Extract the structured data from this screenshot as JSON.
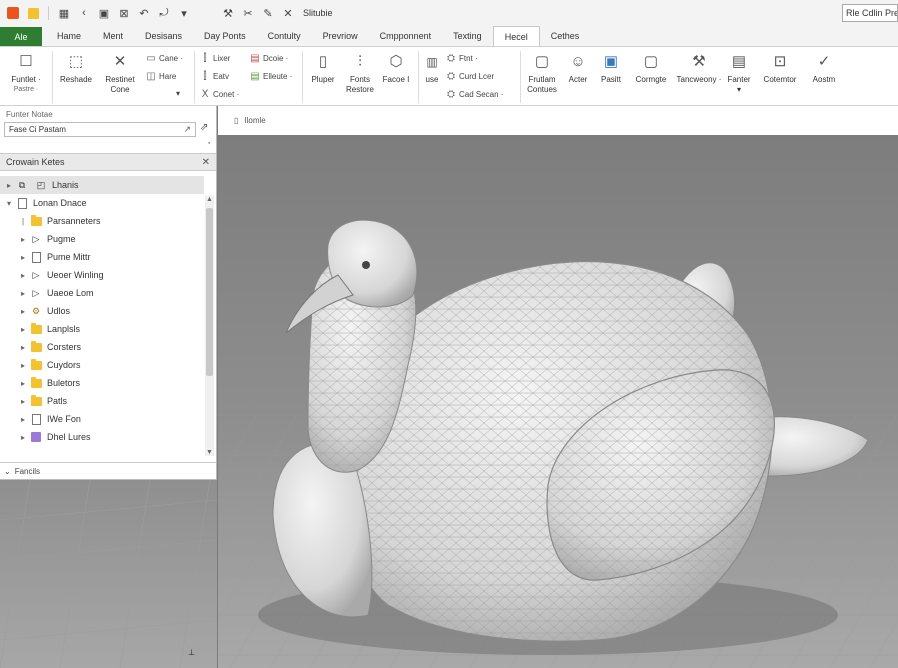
{
  "quick_access": {
    "title": "Slitubie",
    "search_placeholder": "Rle Cdlin Pre"
  },
  "tabs": {
    "file": "Ale",
    "items": [
      "Hame",
      "Ment",
      "Desisans",
      "Day Ponts",
      "Contulty",
      "Prevriow",
      "Cmpponnent",
      "Texting",
      "Hecel",
      "Cethes"
    ],
    "active_index": 8
  },
  "ribbon": {
    "functie": "Funtlet ·",
    "functie_sub": "Pastre ·",
    "reshade": "Reshade",
    "restinet_line1": "Restinet",
    "restinet_line2": "Cone",
    "cane": "Cane ·",
    "hare": "Hare",
    "lixer": "Lixer",
    "eatv": "Eatv",
    "conet": "Conet ·",
    "dcoie": "Dcoie ·",
    "elleute": "Elleute ·",
    "pluper": "Pluper",
    "fonts_line1": "Fonts",
    "fonts_line2": "Restore",
    "facoe": "Facoe I",
    "use": "use",
    "ftnt": "Ftnt ·",
    "curd_lcer": "Curd Lcer",
    "cad_secan": "Cad Secan ·",
    "frutlam_line1": "Frutlam",
    "frutlam_line2": "Contues",
    "acter": "Acter",
    "pasitt": "Pasitt",
    "cormgte": "Cormgte",
    "tancweony": "Tancweony ·",
    "fanter": "Fanter",
    "cotemtor": "Cotemtor",
    "aostm": "Aostm"
  },
  "panel": {
    "find_label": "Funter Notae",
    "find_value": "Fase Ci Pastam",
    "tree_title": "Crowain Ketes",
    "footer_label": "Fancils",
    "items": [
      {
        "label": "Lhanis",
        "icon": "model-icon",
        "twisty": "▸",
        "level": 0
      },
      {
        "label": "Lonan Dnace",
        "icon": "document-icon",
        "twisty": "▾",
        "level": 0
      },
      {
        "label": "Parsanneters",
        "icon": "folder-icon",
        "twisty": "|",
        "level": 1
      },
      {
        "label": "Pugme",
        "icon": "play-icon",
        "twisty": "▸",
        "level": 1
      },
      {
        "label": "Pume Mittr",
        "icon": "document-icon",
        "twisty": "▸",
        "level": 1
      },
      {
        "label": "Ueoer Winling",
        "icon": "play-icon",
        "twisty": "▸",
        "level": 1
      },
      {
        "label": "Uaeoe Lom",
        "icon": "play-icon",
        "twisty": "▸",
        "level": 1
      },
      {
        "label": "Udlos",
        "icon": "gear-icon",
        "twisty": "▸",
        "level": 1
      },
      {
        "label": "Lanplsls",
        "icon": "folder-icon",
        "twisty": "▸",
        "level": 1
      },
      {
        "label": "Corsters",
        "icon": "folder-icon",
        "twisty": "▸",
        "level": 1
      },
      {
        "label": "Cuydors",
        "icon": "folder-icon",
        "twisty": "▸",
        "level": 1
      },
      {
        "label": "Buletors",
        "icon": "folder-icon",
        "twisty": "▸",
        "level": 1
      },
      {
        "label": "Patls",
        "icon": "folder-icon",
        "twisty": "▸",
        "level": 1
      },
      {
        "label": "IWe Fon",
        "icon": "document-icon",
        "twisty": "▸",
        "level": 1
      },
      {
        "label": "Dhel Lures",
        "icon": "purple-icon",
        "twisty": "▸",
        "level": 1
      }
    ]
  },
  "viewport": {
    "label": "Ilomle"
  },
  "colors": {
    "file_tab": "#2e7d32",
    "folder": "#f2c230",
    "viewport_bg": "#7d7d7d"
  }
}
